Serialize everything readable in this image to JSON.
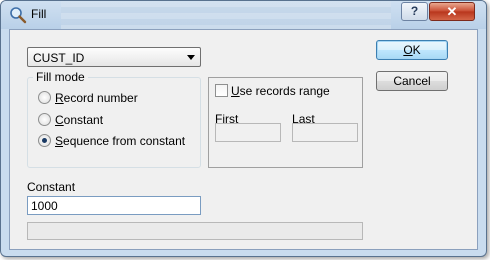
{
  "window": {
    "title": "Fill",
    "help_label": "?",
    "close_label": "✕"
  },
  "field_select": {
    "value": "CUST_ID"
  },
  "fill_mode": {
    "legend": "Fill mode",
    "options": [
      {
        "prefix": "",
        "mnemonic": "R",
        "rest": "ecord number",
        "checked": false
      },
      {
        "prefix": "",
        "mnemonic": "C",
        "rest": "onstant",
        "checked": false
      },
      {
        "prefix": "",
        "mnemonic": "S",
        "rest": "equence from constant",
        "checked": true
      }
    ]
  },
  "records_range": {
    "checkbox_prefix": "",
    "checkbox_mnemonic": "U",
    "checkbox_rest": "se records range",
    "checked": false,
    "first_prefix": "",
    "first_mnemonic": "F",
    "first_rest": "irst",
    "last_prefix": "",
    "last_mnemonic": "L",
    "last_rest": "ast",
    "first_value": "",
    "last_value": ""
  },
  "constant": {
    "label": "Constant",
    "value": "1000"
  },
  "buttons": {
    "ok_mnemonic": "O",
    "ok_rest": "K",
    "cancel": "Cancel"
  }
}
